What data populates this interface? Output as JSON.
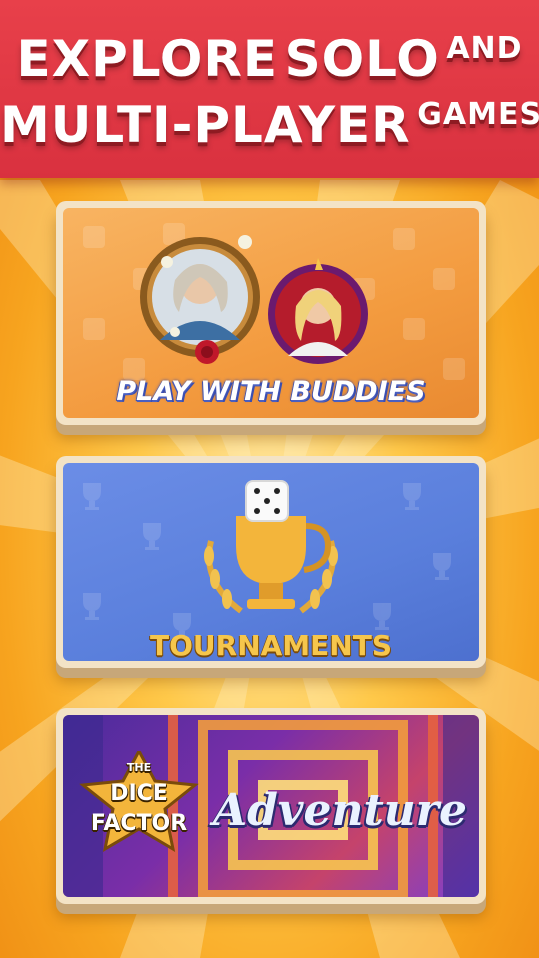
{
  "banner": {
    "line1": {
      "word1": "EXPLORE",
      "word2": "SOLO",
      "word3": "AND"
    },
    "line2": {
      "word1": "MULTI-PLAYER",
      "word2": "GAMES!"
    }
  },
  "cards": [
    {
      "label": "PLAY WITH BUDDIES"
    },
    {
      "label": "TOURNAMENTS"
    },
    {
      "label": "Adventure",
      "logo_line1": "THE",
      "logo_line2": "DICE",
      "logo_line3": "FACTOR"
    }
  ],
  "colors": {
    "banner_red": "#e8404a",
    "background_gold": "#ffc94a",
    "card_orange": "#f39b3f",
    "card_blue": "#5a7fdc",
    "card_purple": "#7a2ea8"
  }
}
